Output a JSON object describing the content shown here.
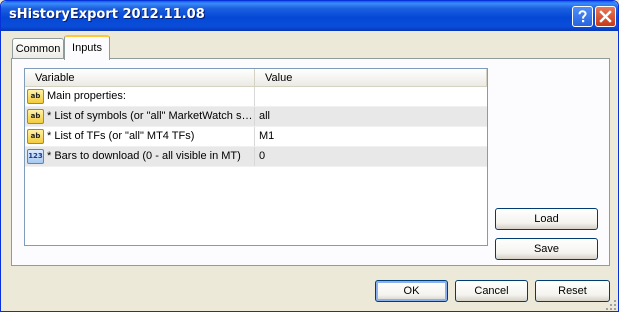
{
  "window": {
    "title": "sHistoryExport 2012.11.08"
  },
  "title_buttons": {
    "help_icon": "question-mark",
    "close_icon": "x-mark"
  },
  "tabs": [
    {
      "label": "Common",
      "active": false
    },
    {
      "label": "Inputs",
      "active": true
    }
  ],
  "grid": {
    "columns": [
      "Variable",
      "Value"
    ],
    "rows": [
      {
        "icon": "ab",
        "icon_name": "string-type-icon",
        "variable": "Main properties:",
        "value": ""
      },
      {
        "icon": "ab",
        "icon_name": "string-type-icon",
        "variable": "* List of symbols (or \"all\" MarketWatch sy...",
        "value": "all"
      },
      {
        "icon": "ab",
        "icon_name": "string-type-icon",
        "variable": "* List of TFs (or \"all\" MT4 TFs)",
        "value": "M1"
      },
      {
        "icon": "123",
        "icon_name": "integer-type-icon",
        "variable": "* Bars to download (0 - all visible in MT)",
        "value": "0"
      }
    ]
  },
  "side_buttons": {
    "load_label": "Load",
    "save_label": "Save"
  },
  "dialog_buttons": {
    "ok_label": "OK",
    "cancel_label": "Cancel",
    "reset_label": "Reset"
  },
  "colors": {
    "titlebar": "#0A4DD8",
    "window_bg": "#ECE9D8",
    "tab_highlight": "#FFC83C",
    "alt_row": "#E8E8E8"
  }
}
